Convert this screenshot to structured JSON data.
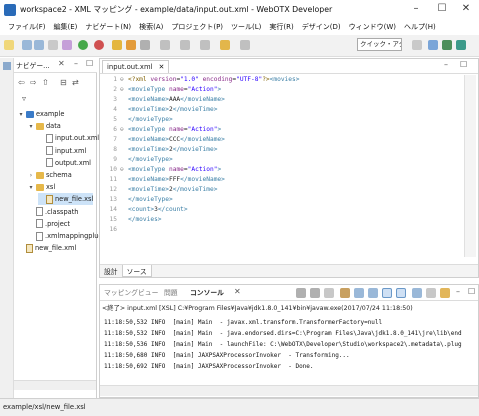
{
  "window": {
    "title": "workspace2 - XML マッピング - example/data/input.out.xml - WebOTX Developer",
    "minimize": "–",
    "maximize": "☐",
    "close": "✕"
  },
  "menu": [
    "ファイル(F)",
    "編集(E)",
    "ナビゲート(N)",
    "検索(A)",
    "プロジェクト(P)",
    "ツール(L)",
    "実行(R)",
    "デザイン(D)",
    "ウィンドウ(W)",
    "ヘルプ(H)"
  ],
  "toolbar": {
    "quick_access": "クイック・アクセス"
  },
  "navigator": {
    "tab_label": "ナビゲー...",
    "tree": [
      {
        "label": "example",
        "type": "project",
        "indent": 0,
        "twisty": "▾"
      },
      {
        "label": "data",
        "type": "folder",
        "indent": 1,
        "twisty": "▾"
      },
      {
        "label": "input.out.xml",
        "type": "file",
        "indent": 2,
        "twisty": ""
      },
      {
        "label": "input.xml",
        "type": "file",
        "indent": 2,
        "twisty": ""
      },
      {
        "label": "output.xml",
        "type": "file",
        "indent": 2,
        "twisty": ""
      },
      {
        "label": "schema",
        "type": "folder",
        "indent": 1,
        "twisty": "›"
      },
      {
        "label": "xsl",
        "type": "folder",
        "indent": 1,
        "twisty": "▾"
      },
      {
        "label": "new_file.xsl",
        "type": "xsl",
        "indent": 2,
        "twisty": "",
        "selected": true
      },
      {
        "label": ".classpath",
        "type": "file",
        "indent": 1,
        "twisty": ""
      },
      {
        "label": ".project",
        "type": "file",
        "indent": 1,
        "twisty": ""
      },
      {
        "label": ".xmlmappingplug",
        "type": "file",
        "indent": 1,
        "twisty": ""
      },
      {
        "label": "new_file.xml",
        "type": "xsl",
        "indent": 0,
        "twisty": ""
      }
    ]
  },
  "editor": {
    "tab_label": "input.out.xml",
    "tab_close": "✕",
    "lines": [
      {
        "n": "1",
        "fold": "⊖",
        "html": "<span class='pi'>&lt;?xml</span> <span class='attr'>version</span>=<span class='val'>\"1.0\"</span> <span class='attr'>encoding</span>=<span class='val'>\"UTF-8\"</span><span class='pi'>?&gt;</span><span class='tag'>&lt;movies&gt;</span>"
      },
      {
        "n": "2",
        "fold": "⊖",
        "html": "<span class='tag'>&lt;movieType</span> <span class='attr'>name</span>=<span class='val'>\"Action\"</span><span class='tag'>&gt;</span>"
      },
      {
        "n": "3",
        "fold": "",
        "html": "<span class='tag'>&lt;movieName&gt;</span>AAA<span class='tag'>&lt;/movieName&gt;</span>"
      },
      {
        "n": "4",
        "fold": "",
        "html": "<span class='tag'>&lt;movieTime&gt;</span>2<span class='tag'>&lt;/movieTime&gt;</span>"
      },
      {
        "n": "5",
        "fold": "",
        "html": "<span class='tag'>&lt;/movieType&gt;</span>"
      },
      {
        "n": "6",
        "fold": "⊖",
        "html": "<span class='tag'>&lt;movieType</span> <span class='attr'>name</span>=<span class='val'>\"Action\"</span><span class='tag'>&gt;</span>"
      },
      {
        "n": "7",
        "fold": "",
        "html": "<span class='tag'>&lt;movieName&gt;</span>CCC<span class='tag'>&lt;/movieName&gt;</span>"
      },
      {
        "n": "8",
        "fold": "",
        "html": "<span class='tag'>&lt;movieTime&gt;</span>2<span class='tag'>&lt;/movieTime&gt;</span>"
      },
      {
        "n": "9",
        "fold": "",
        "html": "<span class='tag'>&lt;/movieType&gt;</span>"
      },
      {
        "n": "10",
        "fold": "⊖",
        "html": "<span class='tag'>&lt;movieType</span> <span class='attr'>name</span>=<span class='val'>\"Action\"</span><span class='tag'>&gt;</span>"
      },
      {
        "n": "11",
        "fold": "",
        "html": "<span class='tag'>&lt;movieName&gt;</span>FFF<span class='tag'>&lt;/movieName&gt;</span>"
      },
      {
        "n": "12",
        "fold": "",
        "html": "<span class='tag'>&lt;movieTime&gt;</span>2<span class='tag'>&lt;/movieTime&gt;</span>"
      },
      {
        "n": "13",
        "fold": "",
        "html": "<span class='tag'>&lt;/movieType&gt;</span>"
      },
      {
        "n": "14",
        "fold": "",
        "html": "<span class='tag'>&lt;count&gt;</span>3<span class='tag'>&lt;/count&gt;</span>"
      },
      {
        "n": "15",
        "fold": "",
        "html": "<span class='tag'>&lt;/movies&gt;</span>"
      },
      {
        "n": "16",
        "fold": "",
        "html": ""
      }
    ],
    "bottom_tabs": [
      "設計",
      "ソース"
    ]
  },
  "console": {
    "tabs": [
      "マッピングビュー",
      "問題",
      "コンソール"
    ],
    "description": "<終了> input.xml [XSL] C:¥Program Files¥Java¥jdk1.8.0_141¥bin¥javaw.exe(2017/07/24 11:18:50)",
    "lines": [
      "11:18:50,532 INFO  [main] Main  - javax.xml.transform.TransformerFactory=null",
      "11:18:50,532 INFO  [main] Main  - java.endorsed.dirs=C:\\Program Files\\Java\\jdk1.8.0_141\\jre\\lib\\end",
      "11:18:50,536 INFO  [main] Main  - launchFile: C:\\WebOTX\\Developer\\Studio\\workspace2\\.metadata\\.plug",
      "11:18:50,680 INFO  [main] JAXPSAXProcessorInvoker  - Transforming...",
      "11:18:50,692 INFO  [main] JAXPSAXProcessorInvoker  - Done."
    ]
  },
  "status": {
    "path": "example/xsl/new_file.xsl"
  }
}
